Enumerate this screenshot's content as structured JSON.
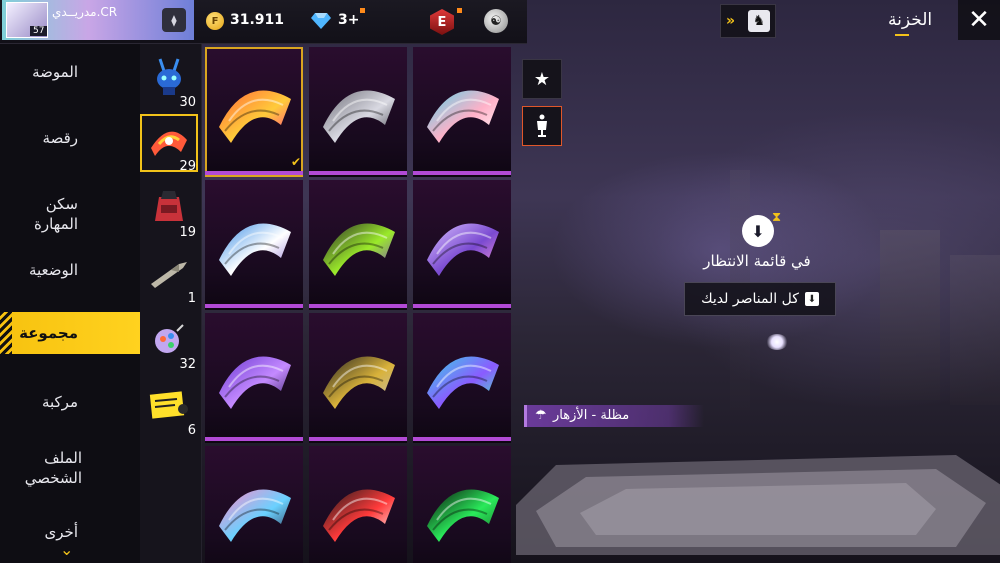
{
  "header": {
    "player_name": "مدريــدي.CR",
    "level": "57",
    "coins": "31.911",
    "diamonds": "3+",
    "ep_badge": "E",
    "page_title": "الخزنة",
    "close_icon": "close-icon",
    "vault_icon": "vault-icon"
  },
  "categories": [
    {
      "label": "الموضة"
    },
    {
      "label": "رقصة"
    },
    {
      "label": "سكن المهارة"
    },
    {
      "label": "الوضعية"
    },
    {
      "label": "مجموعة"
    },
    {
      "label": "مركبة"
    },
    {
      "label": "الملف الشخصي"
    },
    {
      "label": "أخرى"
    }
  ],
  "subcategories": [
    {
      "icon": "bunny-robot-icon",
      "count": "30"
    },
    {
      "icon": "parachute-icon",
      "count": "29"
    },
    {
      "icon": "backpack-icon",
      "count": "19"
    },
    {
      "icon": "skyboard-icon",
      "count": "1"
    },
    {
      "icon": "emote-icon",
      "count": "32"
    },
    {
      "icon": "banner-icon",
      "count": "6"
    }
  ],
  "grid_items": [
    {
      "name": "parachute-skull",
      "colors": [
        "#ff6a3a",
        "#ffcb3a",
        "#ff3a8c"
      ],
      "selected": true
    },
    {
      "name": "parachute-silver",
      "colors": [
        "#6f6f78",
        "#d9d9e2",
        "#3a3a44"
      ],
      "selected": false
    },
    {
      "name": "parachute-cyan-pink",
      "colors": [
        "#5fd1e6",
        "#ffb1c8",
        "#ffffff"
      ],
      "selected": false
    },
    {
      "name": "parachute-blue-wave",
      "colors": [
        "#3a8ee6",
        "#ffffff",
        "#8a6bd1"
      ],
      "selected": false
    },
    {
      "name": "parachute-green-maze",
      "colors": [
        "#2b2b2b",
        "#9bea2a",
        "#7a3ad1"
      ],
      "selected": false
    },
    {
      "name": "parachute-violet",
      "colors": [
        "#d9c2ff",
        "#7a4ad1",
        "#ff9bd6"
      ],
      "selected": false
    },
    {
      "name": "parachute-purple-zigzag",
      "colors": [
        "#6a3ad1",
        "#c48aff",
        "#2a1a55"
      ],
      "selected": false
    },
    {
      "name": "parachute-gold-skull",
      "colors": [
        "#222222",
        "#d9b23a",
        "#bfbfbf"
      ],
      "selected": false
    },
    {
      "name": "parachute-holo",
      "colors": [
        "#3ad1e6",
        "#8a5bff",
        "#3affb2"
      ],
      "selected": false
    },
    {
      "name": "parachute-anime",
      "colors": [
        "#ff8ac8",
        "#6ad1ff",
        "#2a2a44"
      ],
      "selected": false
    },
    {
      "name": "parachute-red-text",
      "colors": [
        "#1a1a1a",
        "#ff3a3a",
        "#ffffff"
      ],
      "selected": false
    },
    {
      "name": "parachute-green-circuit",
      "colors": [
        "#0a0a0a",
        "#2aea5a",
        "#1a6a2a"
      ],
      "selected": false
    }
  ],
  "side_buttons": [
    {
      "icon": "star-icon"
    },
    {
      "icon": "mannequin-icon"
    }
  ],
  "preview": {
    "queue_text": "في قائمة الانتظار",
    "all_items_label": "كل المناصر لديك",
    "item_name": "مظلة - الأزهار"
  },
  "colors": {
    "accent_yellow": "#f7c20f",
    "rarity_purple": "#b24ad6",
    "selected_outline": "#d9a520"
  }
}
